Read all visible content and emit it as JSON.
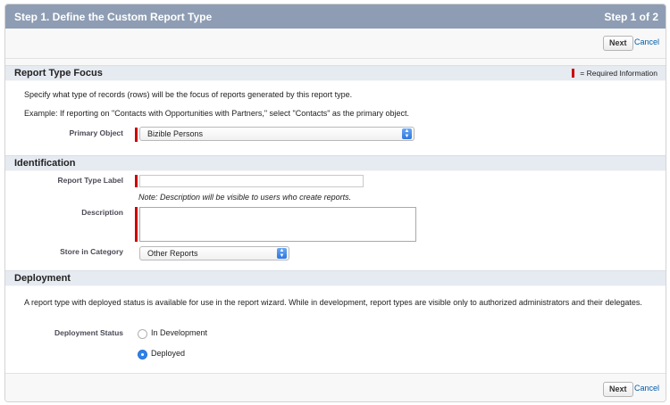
{
  "header": {
    "title": "Step 1. Define the Custom Report Type",
    "step": "Step 1 of 2"
  },
  "actions": {
    "next_label": "Next",
    "cancel_label": "Cancel"
  },
  "required_legend": "= Required Information",
  "focus": {
    "heading": "Report Type Focus",
    "description": "Specify what type of records (rows) will be the focus of reports generated by this report type.",
    "example": "Example: If reporting on \"Contacts with Opportunities with Partners,\" select \"Contacts\" as the primary object.",
    "primary_object_label": "Primary Object",
    "primary_object_value": "Bizible Persons"
  },
  "identification": {
    "heading": "Identification",
    "report_type_label": "Report Type Label",
    "report_type_value": "",
    "note": "Note: Description will be visible to users who create reports.",
    "description_label": "Description",
    "description_value": "",
    "category_label": "Store in Category",
    "category_value": "Other Reports"
  },
  "deployment": {
    "heading": "Deployment",
    "description": "A report type with deployed status is available for use in the report wizard. While in development, report types are visible only to authorized administrators and their delegates.",
    "status_label": "Deployment Status",
    "options": [
      {
        "label": "In Development",
        "selected": false
      },
      {
        "label": "Deployed",
        "selected": true
      }
    ]
  }
}
